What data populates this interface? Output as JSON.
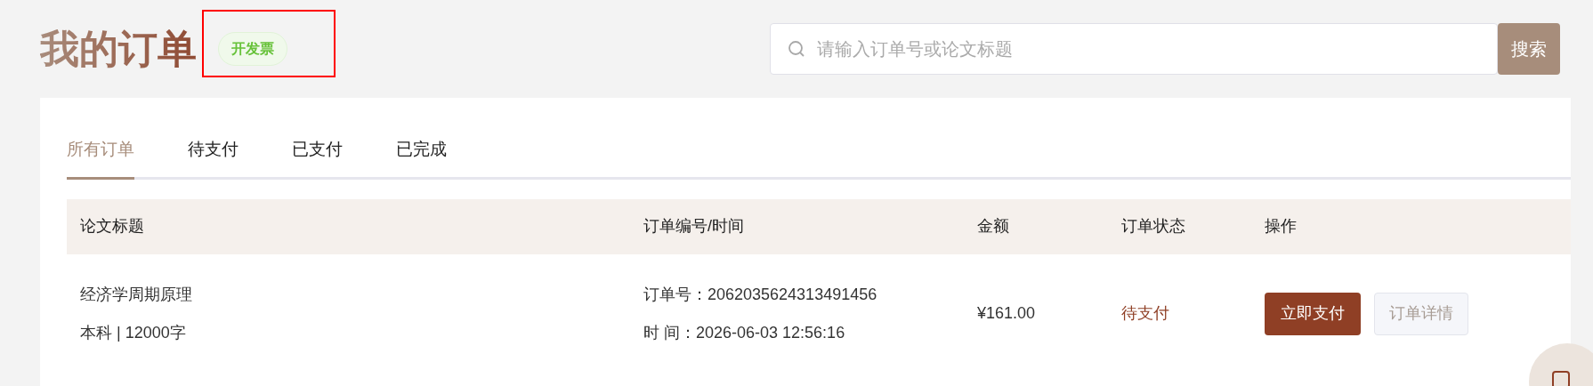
{
  "header": {
    "title": "我的订单",
    "invoice_badge": "开发票",
    "highlighted": true
  },
  "search": {
    "placeholder": "请输入订单号或论文标题",
    "button": "搜索"
  },
  "tabs": [
    {
      "label": "所有订单",
      "selected": true
    },
    {
      "label": "待支付",
      "selected": false
    },
    {
      "label": "已支付",
      "selected": false
    },
    {
      "label": "已完成",
      "selected": false
    }
  ],
  "table": {
    "columns": [
      "论文标题",
      "订单编号/时间",
      "金额",
      "订单状态",
      "操作"
    ],
    "rows": [
      {
        "title": "经济学周期原理",
        "subtitle": "本科 | 12000字",
        "order_no": "订单号：2062035624313491456",
        "time": "时 间：2026-06-03 12:56:16",
        "amount": "¥161.00",
        "status": "待支付",
        "actions": [
          {
            "label": "立即支付",
            "kind": "primary"
          },
          {
            "label": "订单详情",
            "kind": "secondary"
          }
        ]
      }
    ]
  }
}
